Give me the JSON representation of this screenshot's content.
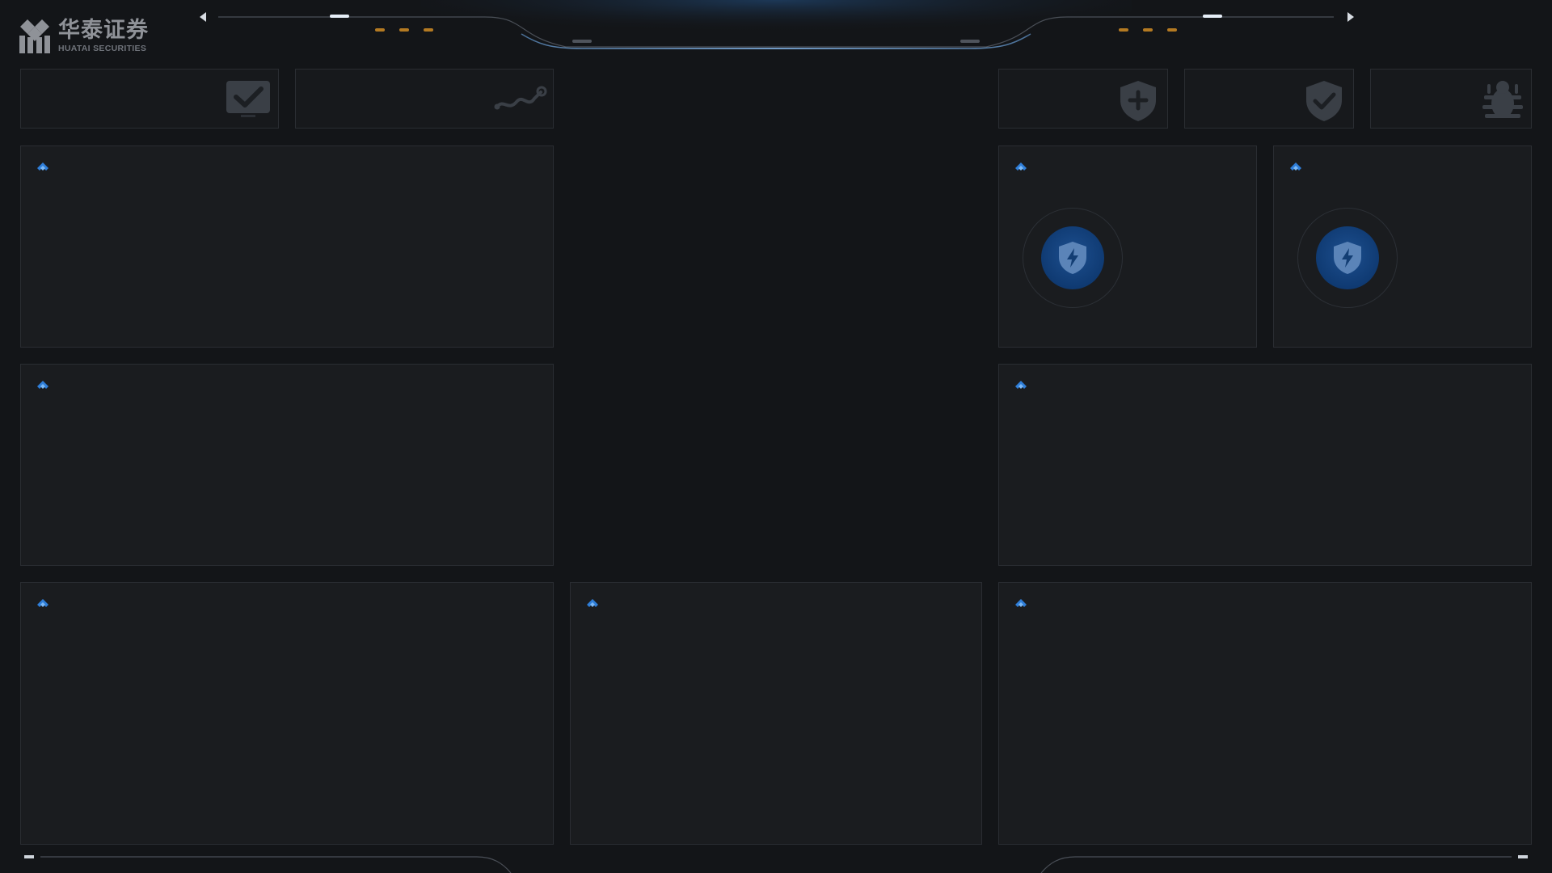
{
  "header": {
    "brand_cn": "华泰证券",
    "brand_en": "HUATAI SECURITIES",
    "accent_color": "#3d8fe0",
    "indicator_color": "#b47a22",
    "prev_icon": "triangle-left-icon",
    "next_icon": "triangle-right-icon"
  },
  "stat_cards": [
    {
      "icon": "checkmark-monitor-icon"
    },
    {
      "icon": "trend-line-icon"
    },
    {
      "icon": "shield-plus-icon"
    },
    {
      "icon": "shield-check-icon"
    },
    {
      "icon": "bug-icon"
    }
  ],
  "panels": {
    "marker_icon": "chevron-up-marker-icon",
    "gauge_icon": "shield-lightning-icon"
  }
}
